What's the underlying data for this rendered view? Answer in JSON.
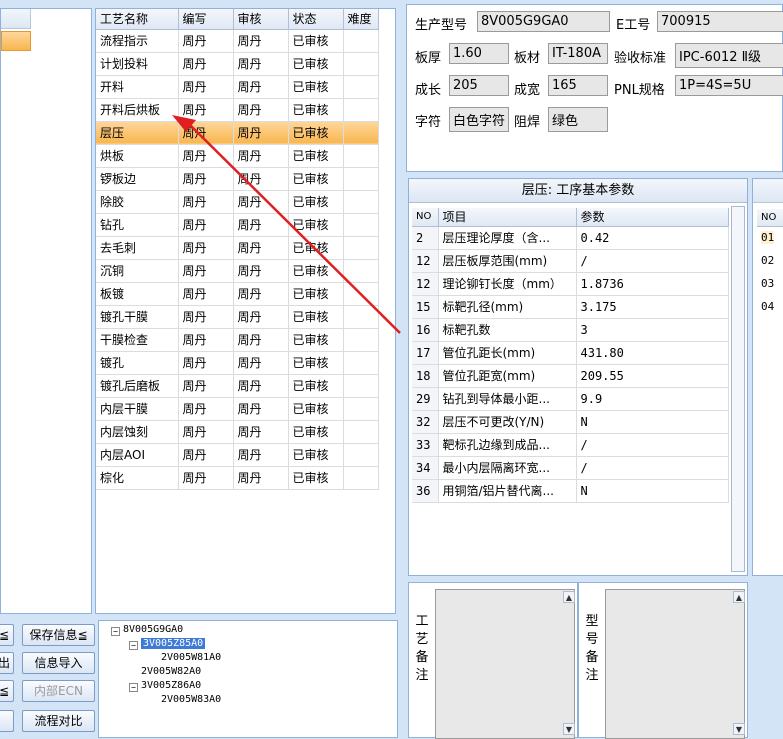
{
  "process_table": {
    "headers": [
      "工艺名称",
      "编写",
      "审核",
      "状态",
      "难度"
    ],
    "rows": [
      {
        "name": "流程指示",
        "author": "周丹",
        "reviewer": "周丹",
        "status": "已审核"
      },
      {
        "name": "计划投料",
        "author": "周丹",
        "reviewer": "周丹",
        "status": "已审核"
      },
      {
        "name": "开料",
        "author": "周丹",
        "reviewer": "周丹",
        "status": "已审核"
      },
      {
        "name": "开料后烘板",
        "author": "周丹",
        "reviewer": "周丹",
        "status": "已审核"
      },
      {
        "name": "层压",
        "author": "周丹",
        "reviewer": "周丹",
        "status": "已审核",
        "selected": true
      },
      {
        "name": "烘板",
        "author": "周丹",
        "reviewer": "周丹",
        "status": "已审核"
      },
      {
        "name": "锣板边",
        "author": "周丹",
        "reviewer": "周丹",
        "status": "已审核"
      },
      {
        "name": "除胶",
        "author": "周丹",
        "reviewer": "周丹",
        "status": "已审核"
      },
      {
        "name": "钻孔",
        "author": "周丹",
        "reviewer": "周丹",
        "status": "已审核"
      },
      {
        "name": "去毛刺",
        "author": "周丹",
        "reviewer": "周丹",
        "status": "已审核"
      },
      {
        "name": "沉铜",
        "author": "周丹",
        "reviewer": "周丹",
        "status": "已审核"
      },
      {
        "name": "板镀",
        "author": "周丹",
        "reviewer": "周丹",
        "status": "已审核"
      },
      {
        "name": "镀孔干膜",
        "author": "周丹",
        "reviewer": "周丹",
        "status": "已审核"
      },
      {
        "name": "干膜检查",
        "author": "周丹",
        "reviewer": "周丹",
        "status": "已审核"
      },
      {
        "name": "镀孔",
        "author": "周丹",
        "reviewer": "周丹",
        "status": "已审核"
      },
      {
        "name": "镀孔后磨板",
        "author": "周丹",
        "reviewer": "周丹",
        "status": "已审核"
      },
      {
        "name": "内层干膜",
        "author": "周丹",
        "reviewer": "周丹",
        "status": "已审核"
      },
      {
        "name": "内层蚀刻",
        "author": "周丹",
        "reviewer": "周丹",
        "status": "已审核"
      },
      {
        "name": "内层AOI",
        "author": "周丹",
        "reviewer": "周丹",
        "status": "已审核"
      },
      {
        "name": "棕化",
        "author": "周丹",
        "reviewer": "周丹",
        "status": "已审核"
      }
    ]
  },
  "info": {
    "model_label": "生产型号",
    "model_value": "8V005G9GA0",
    "eno_label": "E工号",
    "eno_value": "700915",
    "thickness_label": "板厚",
    "thickness_value": "1.60",
    "material_label": "板材",
    "material_value": "IT-180A",
    "standard_label": "验收标准",
    "standard_value": "IPC-6012 Ⅱ级",
    "length_label": "成长",
    "length_value": "205",
    "width_label": "成宽",
    "width_value": "165",
    "pnl_label": "PNL规格",
    "pnl_value": "1P=4S=5U",
    "char_label": "字符",
    "char_value": "白色字符",
    "mask_label": "阻焊",
    "mask_value": "绿色"
  },
  "params": {
    "title": "层压: 工序基本参数",
    "headers": [
      "NO",
      "项目",
      "参数"
    ],
    "rows": [
      {
        "no": "2",
        "item": "层压理论厚度（含...",
        "value": "0.42"
      },
      {
        "no": "12",
        "item": "层压板厚范围(mm)",
        "value": "/"
      },
      {
        "no": "12",
        "item": "理论铆钉长度（mm）",
        "value": "1.8736"
      },
      {
        "no": "15",
        "item": "标靶孔径(mm)",
        "value": "3.175"
      },
      {
        "no": "16",
        "item": "标靶孔数",
        "value": "3"
      },
      {
        "no": "17",
        "item": "管位孔距长(mm)",
        "value": "431.80"
      },
      {
        "no": "18",
        "item": "管位孔距宽(mm)",
        "value": "209.55"
      },
      {
        "no": "29",
        "item": "钻孔到导体最小距...",
        "value": "9.9"
      },
      {
        "no": "32",
        "item": "层压不可更改(Y/N)",
        "value": "N"
      },
      {
        "no": "33",
        "item": "靶标孔边缘到成品...",
        "value": "/"
      },
      {
        "no": "34",
        "item": "最小内层隔离环宽...",
        "value": "/"
      },
      {
        "no": "36",
        "item": "用铜箔/铝片替代离...",
        "value": "N"
      }
    ]
  },
  "right_panel": {
    "header": "NO",
    "rows": [
      "01",
      "02",
      "03",
      "04"
    ]
  },
  "buttons": {
    "save_info": "保存信息≦",
    "info_import": "信息导入",
    "internal_ecn": "内部ECN",
    "flow_compare": "流程对比",
    "left_partial": [
      "≦",
      "出",
      "≦",
      ""
    ]
  },
  "tree": {
    "root": "8V005G9GA0",
    "n1": "3V005Z85A0",
    "n1_child": "2V005W81A0",
    "n2": "2V005W82A0",
    "n3": "3V005Z86A0",
    "n3_child": "2V005W83A0"
  },
  "notes": {
    "process_label": "工艺备注",
    "model_label": "型号备注"
  }
}
